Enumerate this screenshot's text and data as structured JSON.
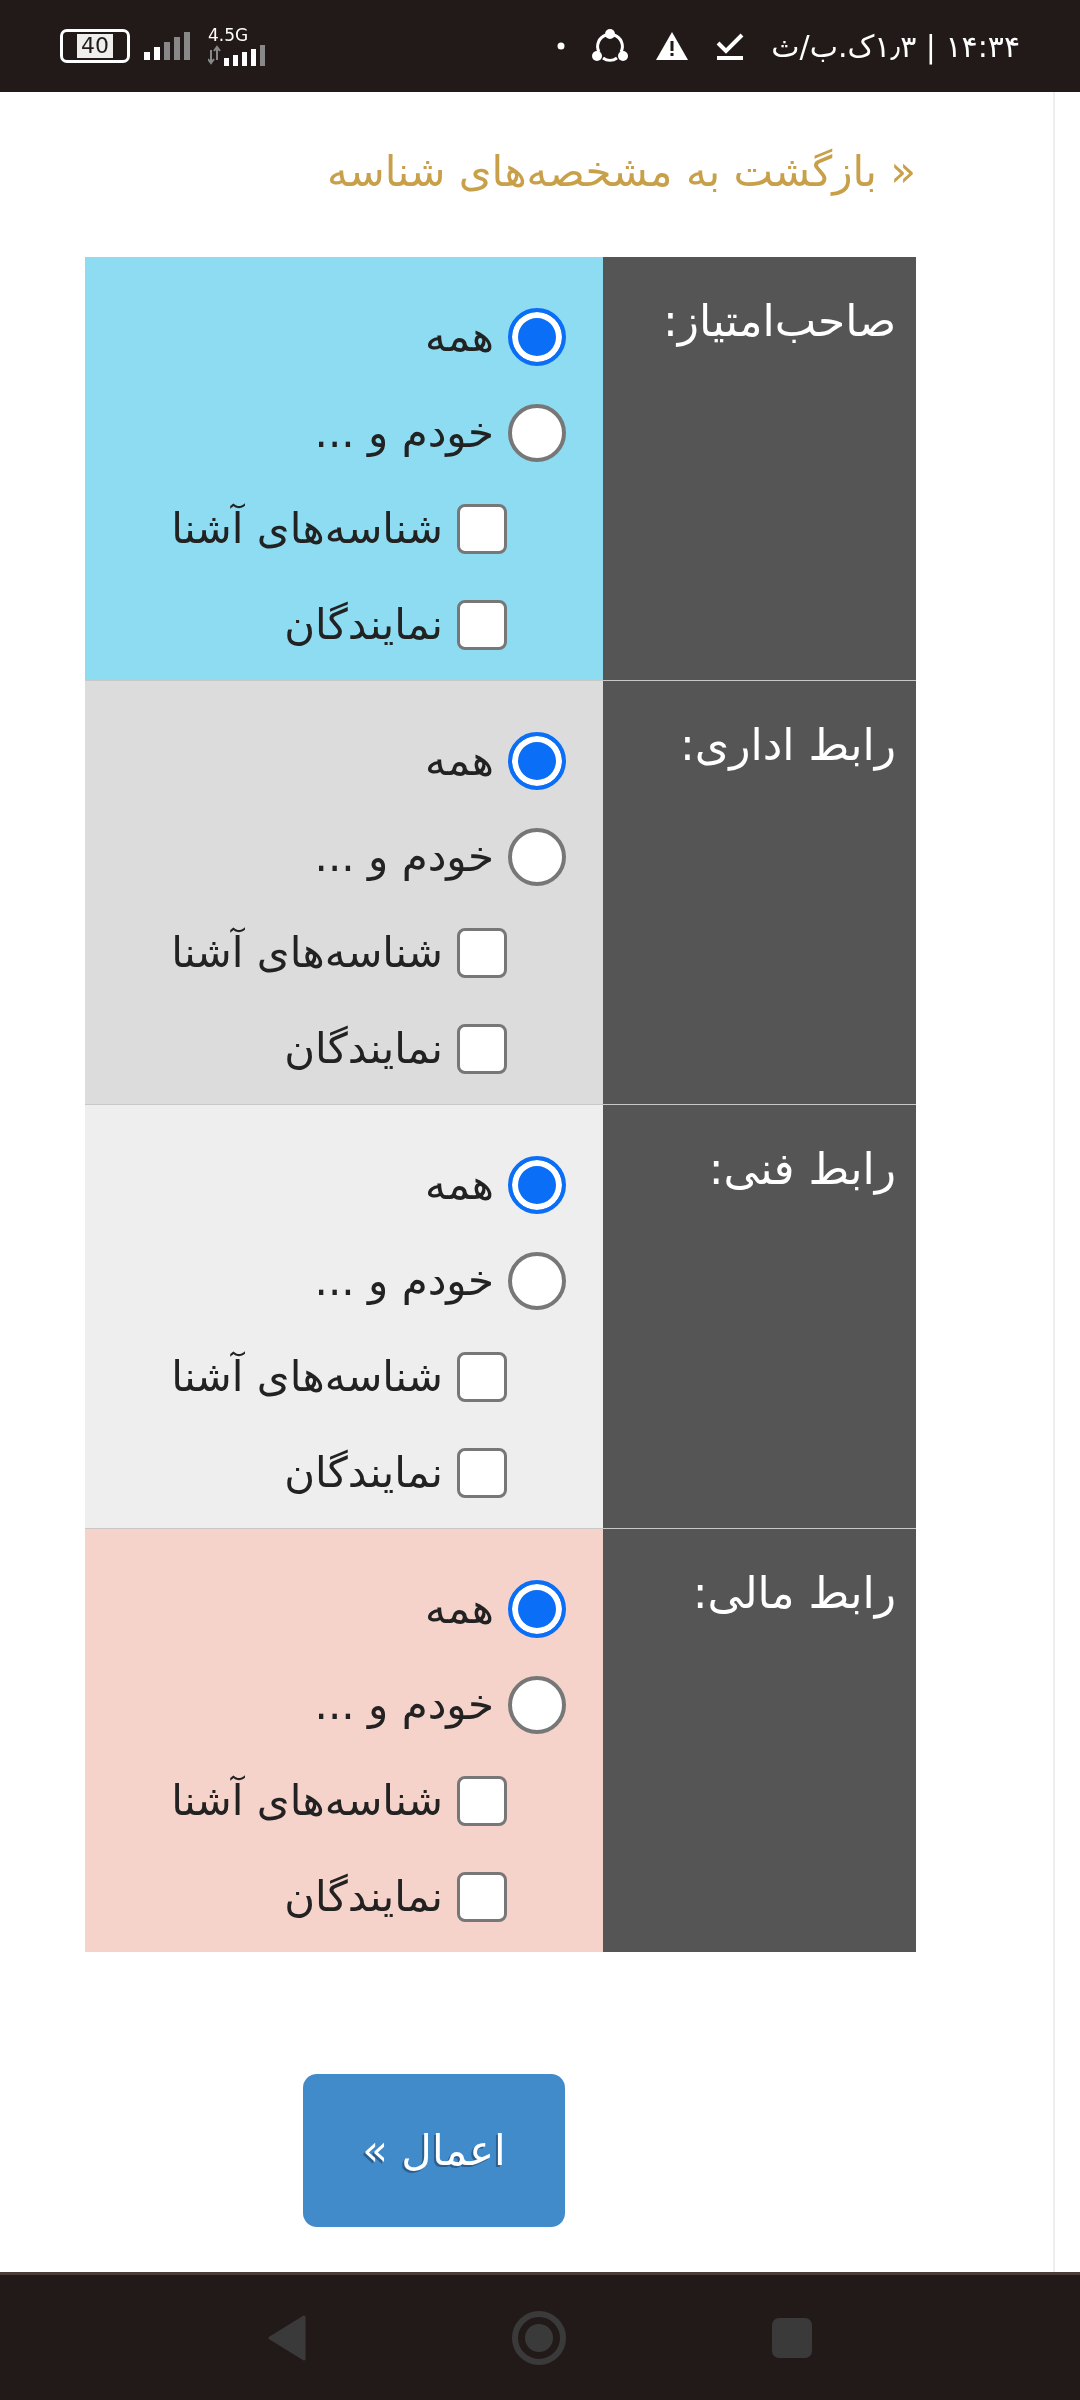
{
  "status_bar": {
    "battery": "40",
    "network": "4.5G",
    "clock": "۱۴:۳۴ | ۱٫۳ک.ب/ث"
  },
  "back_link": "« بازگشت به مشخصه‌های شناسه",
  "sections": [
    {
      "label": "صاحب‌امتیاز:",
      "color": "#8ddcf1",
      "options": [
        {
          "kind": "radio",
          "label": "همه",
          "selected": true
        },
        {
          "kind": "radio",
          "label": "خودم و ...",
          "selected": false
        },
        {
          "kind": "checkbox",
          "label": "شناسه‌های آشنا",
          "checked": false
        },
        {
          "kind": "checkbox",
          "label": "نمایندگان",
          "checked": false
        }
      ]
    },
    {
      "label": "رابط اداری:",
      "color": "#dcdcdc",
      "options": [
        {
          "kind": "radio",
          "label": "همه",
          "selected": true
        },
        {
          "kind": "radio",
          "label": "خودم و ...",
          "selected": false
        },
        {
          "kind": "checkbox",
          "label": "شناسه‌های آشنا",
          "checked": false
        },
        {
          "kind": "checkbox",
          "label": "نمایندگان",
          "checked": false
        }
      ]
    },
    {
      "label": "رابط فنی:",
      "color": "#eeeeee",
      "options": [
        {
          "kind": "radio",
          "label": "همه",
          "selected": true
        },
        {
          "kind": "radio",
          "label": "خودم و ...",
          "selected": false
        },
        {
          "kind": "checkbox",
          "label": "شناسه‌های آشنا",
          "checked": false
        },
        {
          "kind": "checkbox",
          "label": "نمایندگان",
          "checked": false
        }
      ]
    },
    {
      "label": "رابط مالی:",
      "color": "#f5d3ca",
      "options": [
        {
          "kind": "radio",
          "label": "همه",
          "selected": true
        },
        {
          "kind": "radio",
          "label": "خودم و ...",
          "selected": false
        },
        {
          "kind": "checkbox",
          "label": "شناسه‌های آشنا",
          "checked": false
        },
        {
          "kind": "checkbox",
          "label": "نمایندگان",
          "checked": false
        }
      ]
    }
  ],
  "apply_button": "اعمال »"
}
